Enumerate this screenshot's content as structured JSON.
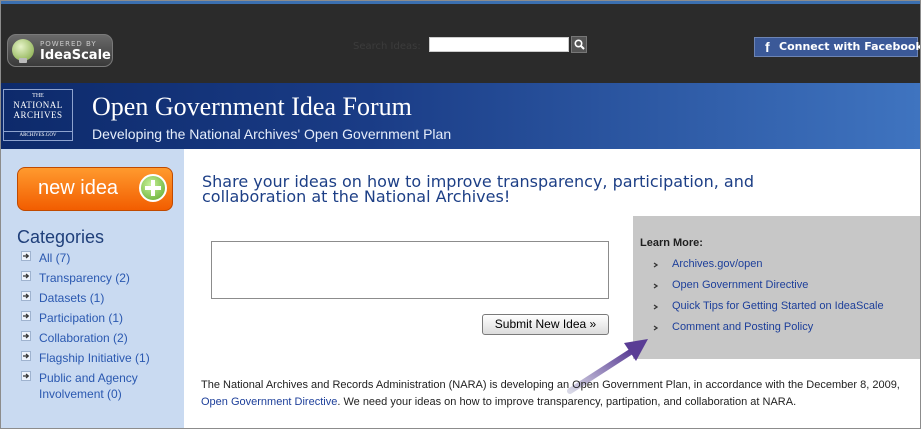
{
  "header": {
    "powered_by": "POWERED BY",
    "brand": "IdeaScale",
    "search_label": "Search Ideas:",
    "search_value": "",
    "search_placeholder": "",
    "facebook_bold": "Connect",
    "facebook_rest": " with Facebook"
  },
  "banner": {
    "logo_line1": "THE",
    "logo_line2": "NATIONAL",
    "logo_line3": "ARCHIVES",
    "logo_line4": "ARCHIVES.GOV",
    "title": "Open Government Idea Forum",
    "subtitle": "Developing the National Archives' Open Government Plan"
  },
  "sidebar": {
    "new_idea_label": "new idea",
    "categories_title": "Categories",
    "categories": [
      {
        "label": "All (7)"
      },
      {
        "label": "Transparency (2)"
      },
      {
        "label": "Datasets (1)"
      },
      {
        "label": "Participation (1)"
      },
      {
        "label": "Collaboration (2)"
      },
      {
        "label": "Flagship Initiative (1)"
      },
      {
        "label": "Public and Agency Involvement (0)"
      }
    ]
  },
  "main": {
    "headline": "Share your ideas on how to improve transparency, participation, and collaboration at the National Archives!",
    "idea_value": "",
    "submit_label": "Submit New Idea »",
    "learn_more_title": "Learn More:",
    "learn_more_links": [
      {
        "label": "Archives.gov/open"
      },
      {
        "label": "Open Government Directive"
      },
      {
        "label": "Quick Tips for Getting Started on IdeaScale"
      },
      {
        "label": "Comment and Posting Policy"
      }
    ],
    "intro_part1": "The National Archives and Records Administration (NARA) is developing an Open Government Plan, in accordance with the December 8, 2009, ",
    "intro_link": "Open Government Directive",
    "intro_part2": ". We need your ideas on how to improve transparency, partipation, and collaboration at NARA."
  },
  "colors": {
    "topbar": "#2b2b2b",
    "banner": "#1a3c86",
    "sidebar": "#c9daf1",
    "new_idea": "#f25d00",
    "facebook": "#3b5998",
    "learn_more_bg": "#c7c7c7",
    "annotation_arrow": "#6b4fa0"
  },
  "icons": {
    "search": "magnifier-icon",
    "facebook": "facebook-f-icon",
    "plus": "plus-circle-icon",
    "category_arrow": "arrow-right-icon",
    "learn_bullet": "chevron-right-icon",
    "annotation": "arrow-icon"
  }
}
